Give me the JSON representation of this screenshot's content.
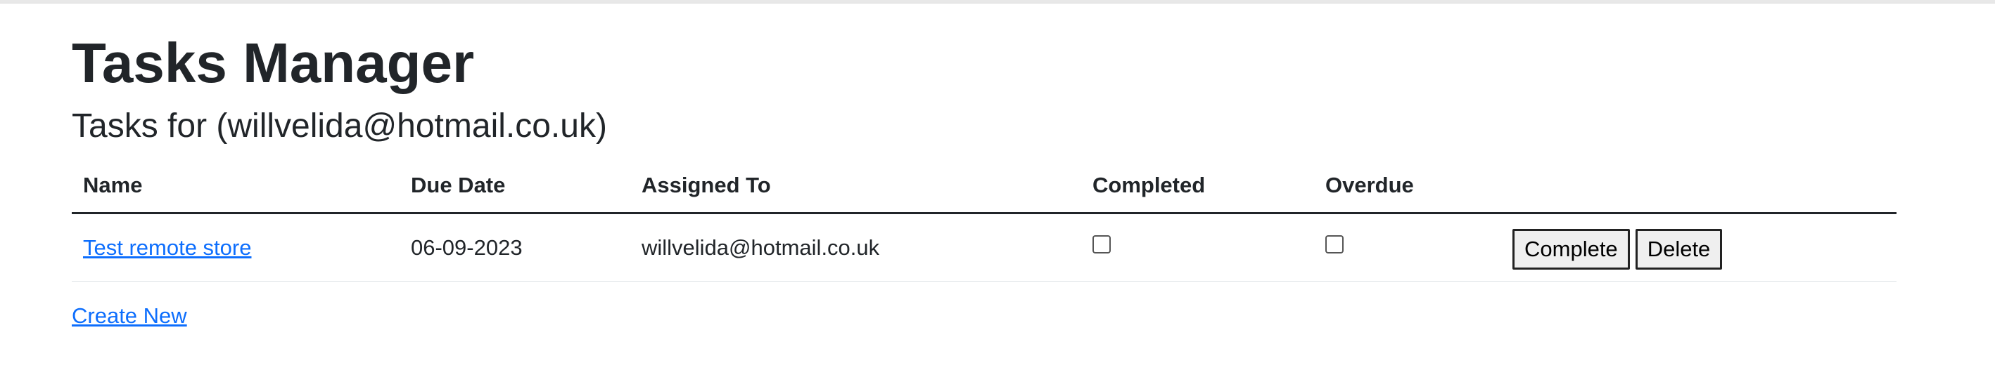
{
  "page": {
    "title": "Tasks Manager",
    "subtitle": "Tasks for (willvelida@hotmail.co.uk)"
  },
  "table": {
    "headers": {
      "name": "Name",
      "due_date": "Due Date",
      "assigned_to": "Assigned To",
      "completed": "Completed",
      "overdue": "Overdue"
    },
    "rows": [
      {
        "name": "Test remote store",
        "due_date": "06-09-2023",
        "assigned_to": "willvelida@hotmail.co.uk",
        "completed": false,
        "overdue": false,
        "complete_label": "Complete",
        "delete_label": "Delete"
      }
    ]
  },
  "actions": {
    "create_new": "Create New"
  },
  "colors": {
    "link": "#0d6efd",
    "text": "#212529"
  }
}
